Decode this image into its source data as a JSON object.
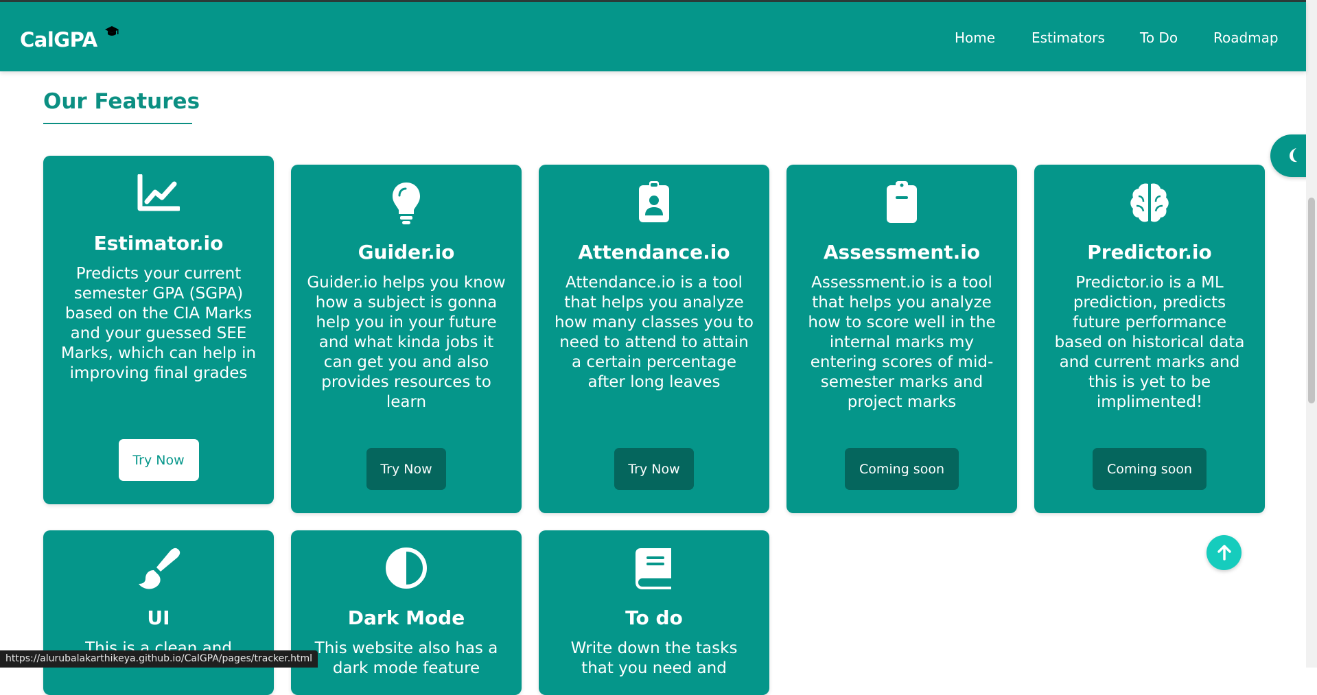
{
  "navbar": {
    "brand": "CalGPA",
    "links": [
      "Home",
      "Estimators",
      "To Do",
      "Roadmap"
    ]
  },
  "section": {
    "title": "Our Features"
  },
  "cards": [
    {
      "title": "Estimator.io",
      "icon": "chart-line-icon",
      "description": "Predicts your current semester GPA (SGPA) based on the CIA Marks and your guessed SEE Marks, which can help in improving final grades",
      "button": "Try Now"
    },
    {
      "title": "Guider.io",
      "icon": "lightbulb-icon",
      "description": "Guider.io helps you know how a subject is gonna help you in your future and what kinda jobs it can get you and also provides resources to learn",
      "button": "Try Now"
    },
    {
      "title": "Attendance.io",
      "icon": "id-badge-icon",
      "description": "Attendance.io is a tool that helps you analyze how many classes you to need to attend to attain a certain percentage after long leaves",
      "button": "Try Now"
    },
    {
      "title": "Assessment.io",
      "icon": "clipboard-icon",
      "description": "Assessment.io is a tool that helps you analyze how to score well in the internal marks my entering scores of mid-semester marks and project marks",
      "button": "Coming soon"
    },
    {
      "title": "Predictor.io",
      "icon": "brain-icon",
      "description": "Predictor.io is a ML prediction, predicts future performance based on historical data and current marks and this is yet to be implimented!",
      "button": "Coming soon"
    },
    {
      "title": "UI",
      "icon": "paintbrush-icon",
      "description": "This is a clean and"
    },
    {
      "title": "Dark Mode",
      "icon": "half-circle-icon",
      "description": "This website also has a dark mode feature"
    },
    {
      "title": "To do",
      "icon": "book-icon",
      "description": "Write down the tasks that you need and"
    }
  ],
  "status_bar": {
    "url": "https://alurubalakarthikeya.github.io/CalGPA/pages/tracker.html"
  },
  "colors": {
    "primary": "#05968a",
    "button_dark": "#05665d",
    "scroll_top": "#16ccbd"
  }
}
